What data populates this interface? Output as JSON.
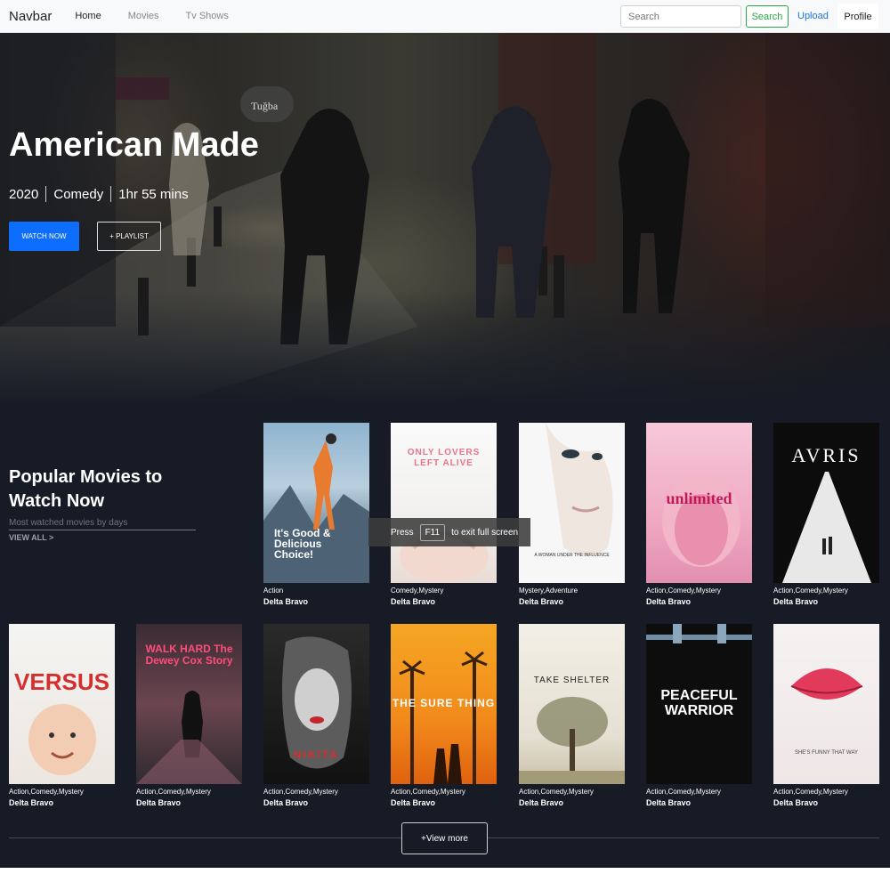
{
  "navbar": {
    "brand": "Navbar",
    "links": [
      "Home",
      "Movies",
      "Tv Shows"
    ],
    "search_placeholder": "Search",
    "search_button": "Search",
    "upload": "Upload",
    "profile": "Profile"
  },
  "hero": {
    "title": "American Made",
    "year": "2020",
    "genre": "Comedy",
    "duration": "1hr 55 mins",
    "watch_now": "WATCH NOW",
    "playlist": "+ PLAYLIST"
  },
  "popular": {
    "title": "Popular Movies to Watch Now",
    "subtitle": "Most watched movies by days",
    "view_all": "VIEW ALL >",
    "view_more": "+View more",
    "row1": [
      {
        "genre": "Action",
        "studio": "Delta Bravo",
        "poster_text": "It's Good & Delicious Choice!"
      },
      {
        "genre": "Comedy,Mystery",
        "studio": "Delta Bravo",
        "poster_text": "ONLY LOVERS LEFT ALIVE"
      },
      {
        "genre": "Mystery,Adventure",
        "studio": "Delta Bravo",
        "poster_text": "A WOMAN UNDER THE INFLUENCE"
      },
      {
        "genre": "Action,Comedy,Mystery",
        "studio": "Delta Bravo",
        "poster_text": "unlimited"
      },
      {
        "genre": "Action,Comedy,Mystery",
        "studio": "Delta Bravo",
        "poster_text": "AVRIS"
      }
    ],
    "row2": [
      {
        "genre": "Action,Comedy,Mystery",
        "studio": "Delta Bravo",
        "poster_text": "VERSUS"
      },
      {
        "genre": "Action,Comedy,Mystery",
        "studio": "Delta Bravo",
        "poster_text": "WALK HARD The Dewey Cox Story"
      },
      {
        "genre": "Action,Comedy,Mystery",
        "studio": "Delta Bravo",
        "poster_text": "NIKITA"
      },
      {
        "genre": "Action,Comedy,Mystery",
        "studio": "Delta Bravo",
        "poster_text": "THE SURE THING"
      },
      {
        "genre": "Action,Comedy,Mystery",
        "studio": "Delta Bravo",
        "poster_text": "TAKE SHELTER"
      },
      {
        "genre": "Action,Comedy,Mystery",
        "studio": "Delta Bravo",
        "poster_text": "PEACEFUL WARRIOR"
      },
      {
        "genre": "Action,Comedy,Mystery",
        "studio": "Delta Bravo",
        "poster_text": "SHE'S FUNNY THAT WAY"
      }
    ]
  },
  "fullscreen_toast": {
    "press": "Press",
    "key": "F11",
    "rest": "to exit full screen"
  }
}
